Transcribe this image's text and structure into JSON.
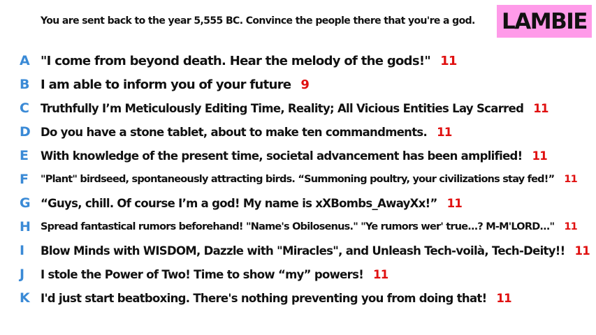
{
  "prompt": "You are sent back to the year 5,555 BC. Convince the people there that you're a god.",
  "badge": {
    "label": "LAMBIE",
    "color": "#ff9be9"
  },
  "colors": {
    "letter": "#3a8ad6",
    "score": "#e01010"
  },
  "answers": [
    {
      "letter": "A",
      "text": "\"I come from beyond death. Hear the melody of the gods!\"",
      "score": "11"
    },
    {
      "letter": "B",
      "text": "I am able to inform you of your future",
      "score": "9"
    },
    {
      "letter": "C",
      "text": "Truthfully I’m Meticulously Editing Time, Reality; All Vicious Entities Lay Scarred",
      "score": "11"
    },
    {
      "letter": "D",
      "text": "Do you have a stone tablet, about to make ten commandments.",
      "score": "11"
    },
    {
      "letter": "E",
      "text": "With knowledge of the present time, societal advancement has been amplified!",
      "score": "11"
    },
    {
      "letter": "F",
      "text": "\"Plant\" birdseed, spontaneously attracting birds. “Summoning poultry, your civilizations stay fed!”",
      "score": "11"
    },
    {
      "letter": "G",
      "text": "“Guys, chill. Of course I’m a god! My name is xXBombs_AwayXx!”",
      "score": "11"
    },
    {
      "letter": "H",
      "text": "Spread fantastical rumors beforehand! \"Name's Obilosenus.\" \"Ye rumors wer' true...? M-M'LORD...\"",
      "score": "11"
    },
    {
      "letter": "I",
      "text": "Blow Minds with WISDOM, Dazzle with \"Miracles\", and Unleash Tech-voilà, Tech-Deity!!",
      "score": "11"
    },
    {
      "letter": "J",
      "text": "I stole the Power of Two! Time to show “my” powers!",
      "score": "11"
    },
    {
      "letter": "K",
      "text": "I'd just start beatboxing. There's nothing preventing you from doing that!",
      "score": "11"
    }
  ]
}
